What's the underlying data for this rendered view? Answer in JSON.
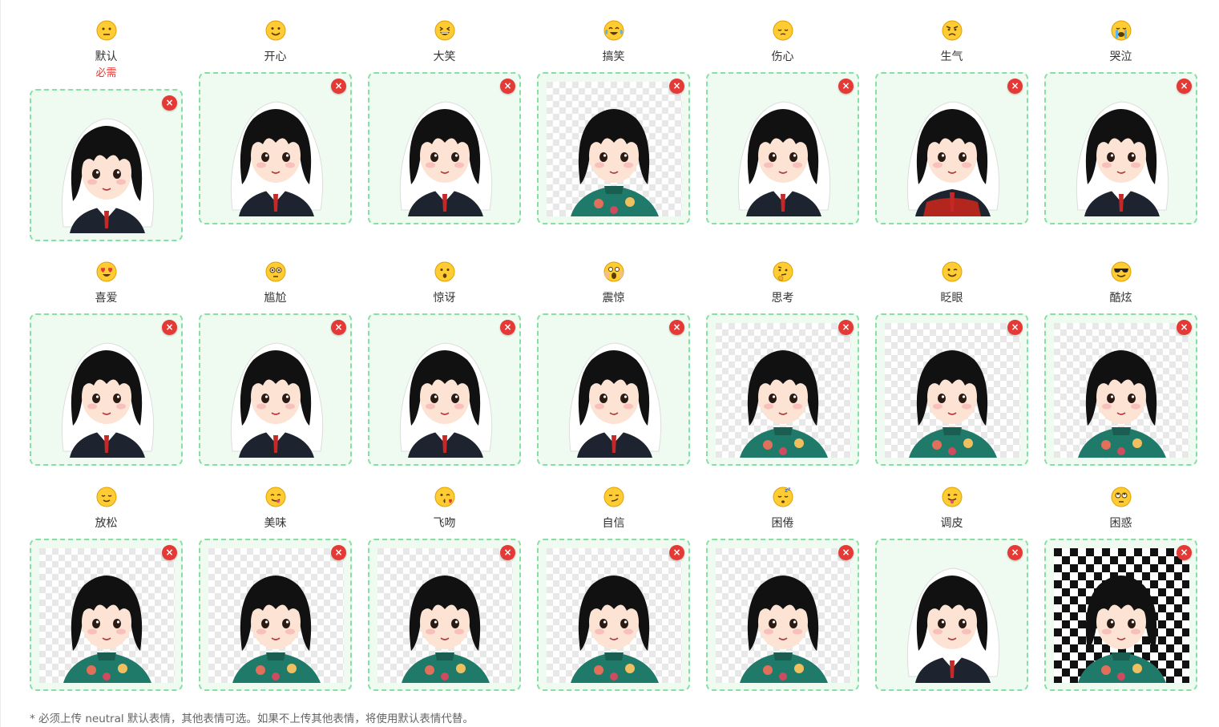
{
  "colors": {
    "accent": "#86e0a3",
    "panel": "#effbf1",
    "danger": "#e53935"
  },
  "expressions": [
    {
      "label": "默认",
      "required": "必需",
      "icon": "neutral-face-icon",
      "bg": "sticker",
      "outfit": "school",
      "delete_label": "×"
    },
    {
      "label": "开心",
      "icon": "smiling-face-icon",
      "bg": "sticker",
      "outfit": "school",
      "delete_label": "×"
    },
    {
      "label": "大笑",
      "icon": "grinning-squinting-face-icon",
      "bg": "sticker",
      "outfit": "school",
      "delete_label": "×"
    },
    {
      "label": "搞笑",
      "icon": "face-with-tears-of-joy-icon",
      "bg": "checker",
      "outfit": "qipao",
      "delete_label": "×"
    },
    {
      "label": "伤心",
      "icon": "pensive-face-icon",
      "bg": "sticker",
      "outfit": "school",
      "delete_label": "×"
    },
    {
      "label": "生气",
      "icon": "angry-face-icon",
      "bg": "sticker",
      "outfit": "qipao-red",
      "delete_label": "×"
    },
    {
      "label": "哭泣",
      "icon": "crying-face-icon",
      "bg": "sticker",
      "outfit": "school",
      "delete_label": "×"
    },
    {
      "label": "喜爱",
      "icon": "heart-eyes-face-icon",
      "bg": "sticker",
      "outfit": "school",
      "delete_label": "×"
    },
    {
      "label": "尴尬",
      "icon": "flushed-face-icon",
      "bg": "sticker",
      "outfit": "school",
      "delete_label": "×"
    },
    {
      "label": "惊讶",
      "icon": "hushed-face-icon",
      "bg": "sticker",
      "outfit": "school",
      "delete_label": "×"
    },
    {
      "label": "震惊",
      "icon": "screaming-face-icon",
      "bg": "sticker",
      "outfit": "school",
      "delete_label": "×"
    },
    {
      "label": "思考",
      "icon": "thinking-face-icon",
      "bg": "checker",
      "outfit": "qipao",
      "delete_label": "×"
    },
    {
      "label": "眨眼",
      "icon": "winking-face-icon",
      "bg": "checker",
      "outfit": "qipao",
      "delete_label": "×"
    },
    {
      "label": "酷炫",
      "icon": "sunglasses-face-icon",
      "bg": "checker",
      "outfit": "qipao",
      "delete_label": "×"
    },
    {
      "label": "放松",
      "icon": "relieved-face-icon",
      "bg": "checker",
      "outfit": "qipao",
      "delete_label": "×"
    },
    {
      "label": "美味",
      "icon": "yum-face-icon",
      "bg": "checker",
      "outfit": "qipao",
      "delete_label": "×"
    },
    {
      "label": "飞吻",
      "icon": "blowing-kiss-face-icon",
      "bg": "checker",
      "outfit": "qipao",
      "delete_label": "×"
    },
    {
      "label": "自信",
      "icon": "smirking-face-icon",
      "bg": "checker",
      "outfit": "qipao",
      "delete_label": "×"
    },
    {
      "label": "困倦",
      "icon": "sleeping-face-icon",
      "bg": "checker",
      "outfit": "qipao",
      "delete_label": "×"
    },
    {
      "label": "调皮",
      "icon": "tongue-out-face-icon",
      "bg": "sticker",
      "outfit": "school",
      "delete_label": "×"
    },
    {
      "label": "困惑",
      "icon": "eye-roll-face-icon",
      "bg": "checker-dark",
      "outfit": "qipao",
      "delete_label": "×"
    }
  ],
  "footer_note": "* 必须上传 neutral 默认表情，其他表情可选。如果不上传其他表情，将使用默认表情代替。"
}
